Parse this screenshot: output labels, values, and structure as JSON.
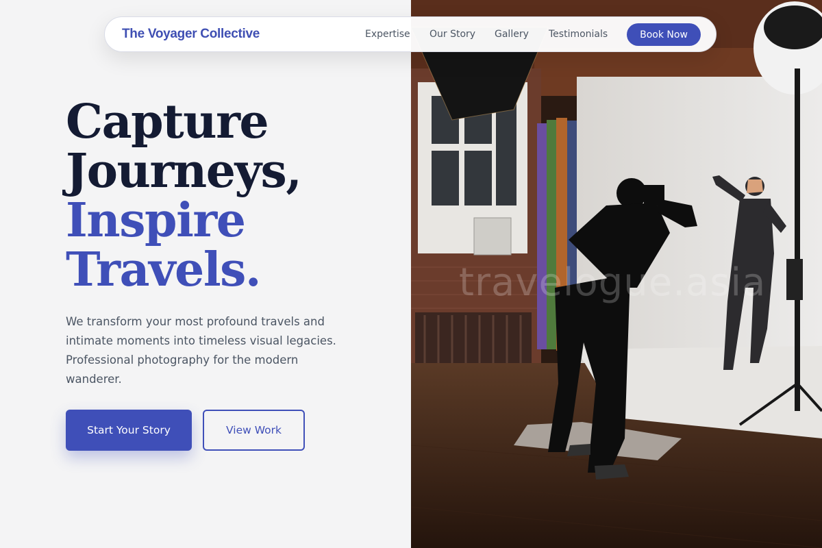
{
  "nav": {
    "brand": "The Voyager Collective",
    "links": [
      "Expertise",
      "Our Story",
      "Gallery",
      "Testimonials"
    ],
    "cta": "Book Now"
  },
  "hero": {
    "title_lines": [
      "Capture",
      "Journeys,",
      "Inspire",
      "Travels."
    ],
    "description": "We transform your most profound travels and intimate moments into timeless visual legacies. Professional photography for the modern wanderer.",
    "primary_button": "Start Your Story",
    "secondary_button": "View Work"
  },
  "image": {
    "watermark": "travelogue.asia",
    "subject": "photographer-shooting-model-in-studio"
  },
  "colors": {
    "accent": "#3f4fb8",
    "heading_dark": "#141b33",
    "body_text": "#4b5563",
    "page_bg": "#f4f4f5"
  }
}
